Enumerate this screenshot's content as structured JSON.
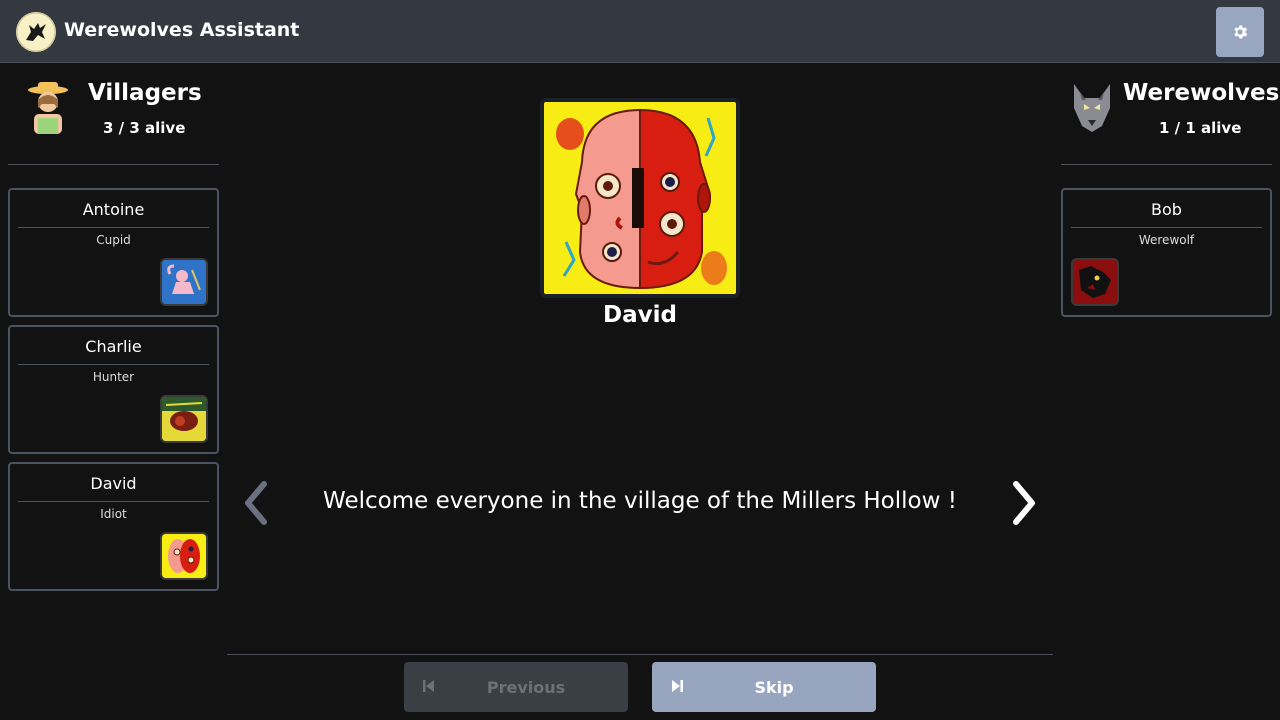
{
  "header": {
    "title": "Werewolves Assistant",
    "logo_icon": "howling-wolf-icon",
    "settings_icon": "gear-icon"
  },
  "teams": {
    "villagers": {
      "name": "Villagers",
      "alive": "3 / 3 alive",
      "icon": "villager-woman-icon"
    },
    "werewolves": {
      "name": "Werewolves",
      "alive": "1 / 1 alive",
      "icon": "wolf-head-icon"
    }
  },
  "villager_players": [
    {
      "name": "Antoine",
      "role": "Cupid",
      "role_icon": "cupid-icon"
    },
    {
      "name": "Charlie",
      "role": "Hunter",
      "role_icon": "hunter-icon"
    },
    {
      "name": "David",
      "role": "Idiot",
      "role_icon": "idiot-icon"
    }
  ],
  "werewolf_players": [
    {
      "name": "Bob",
      "role": "Werewolf",
      "role_icon": "werewolf-icon"
    }
  ],
  "current": {
    "name": "David",
    "role_icon": "idiot-icon"
  },
  "message": "Welcome everyone in the village of the Millers Hollow !",
  "navigation": {
    "previous_label": "Previous",
    "skip_label": "Skip",
    "previous_enabled": false
  },
  "colors": {
    "topbar": "#343840",
    "background": "#121212",
    "accent": "#98a5bf",
    "card_border": "#4c5260"
  }
}
